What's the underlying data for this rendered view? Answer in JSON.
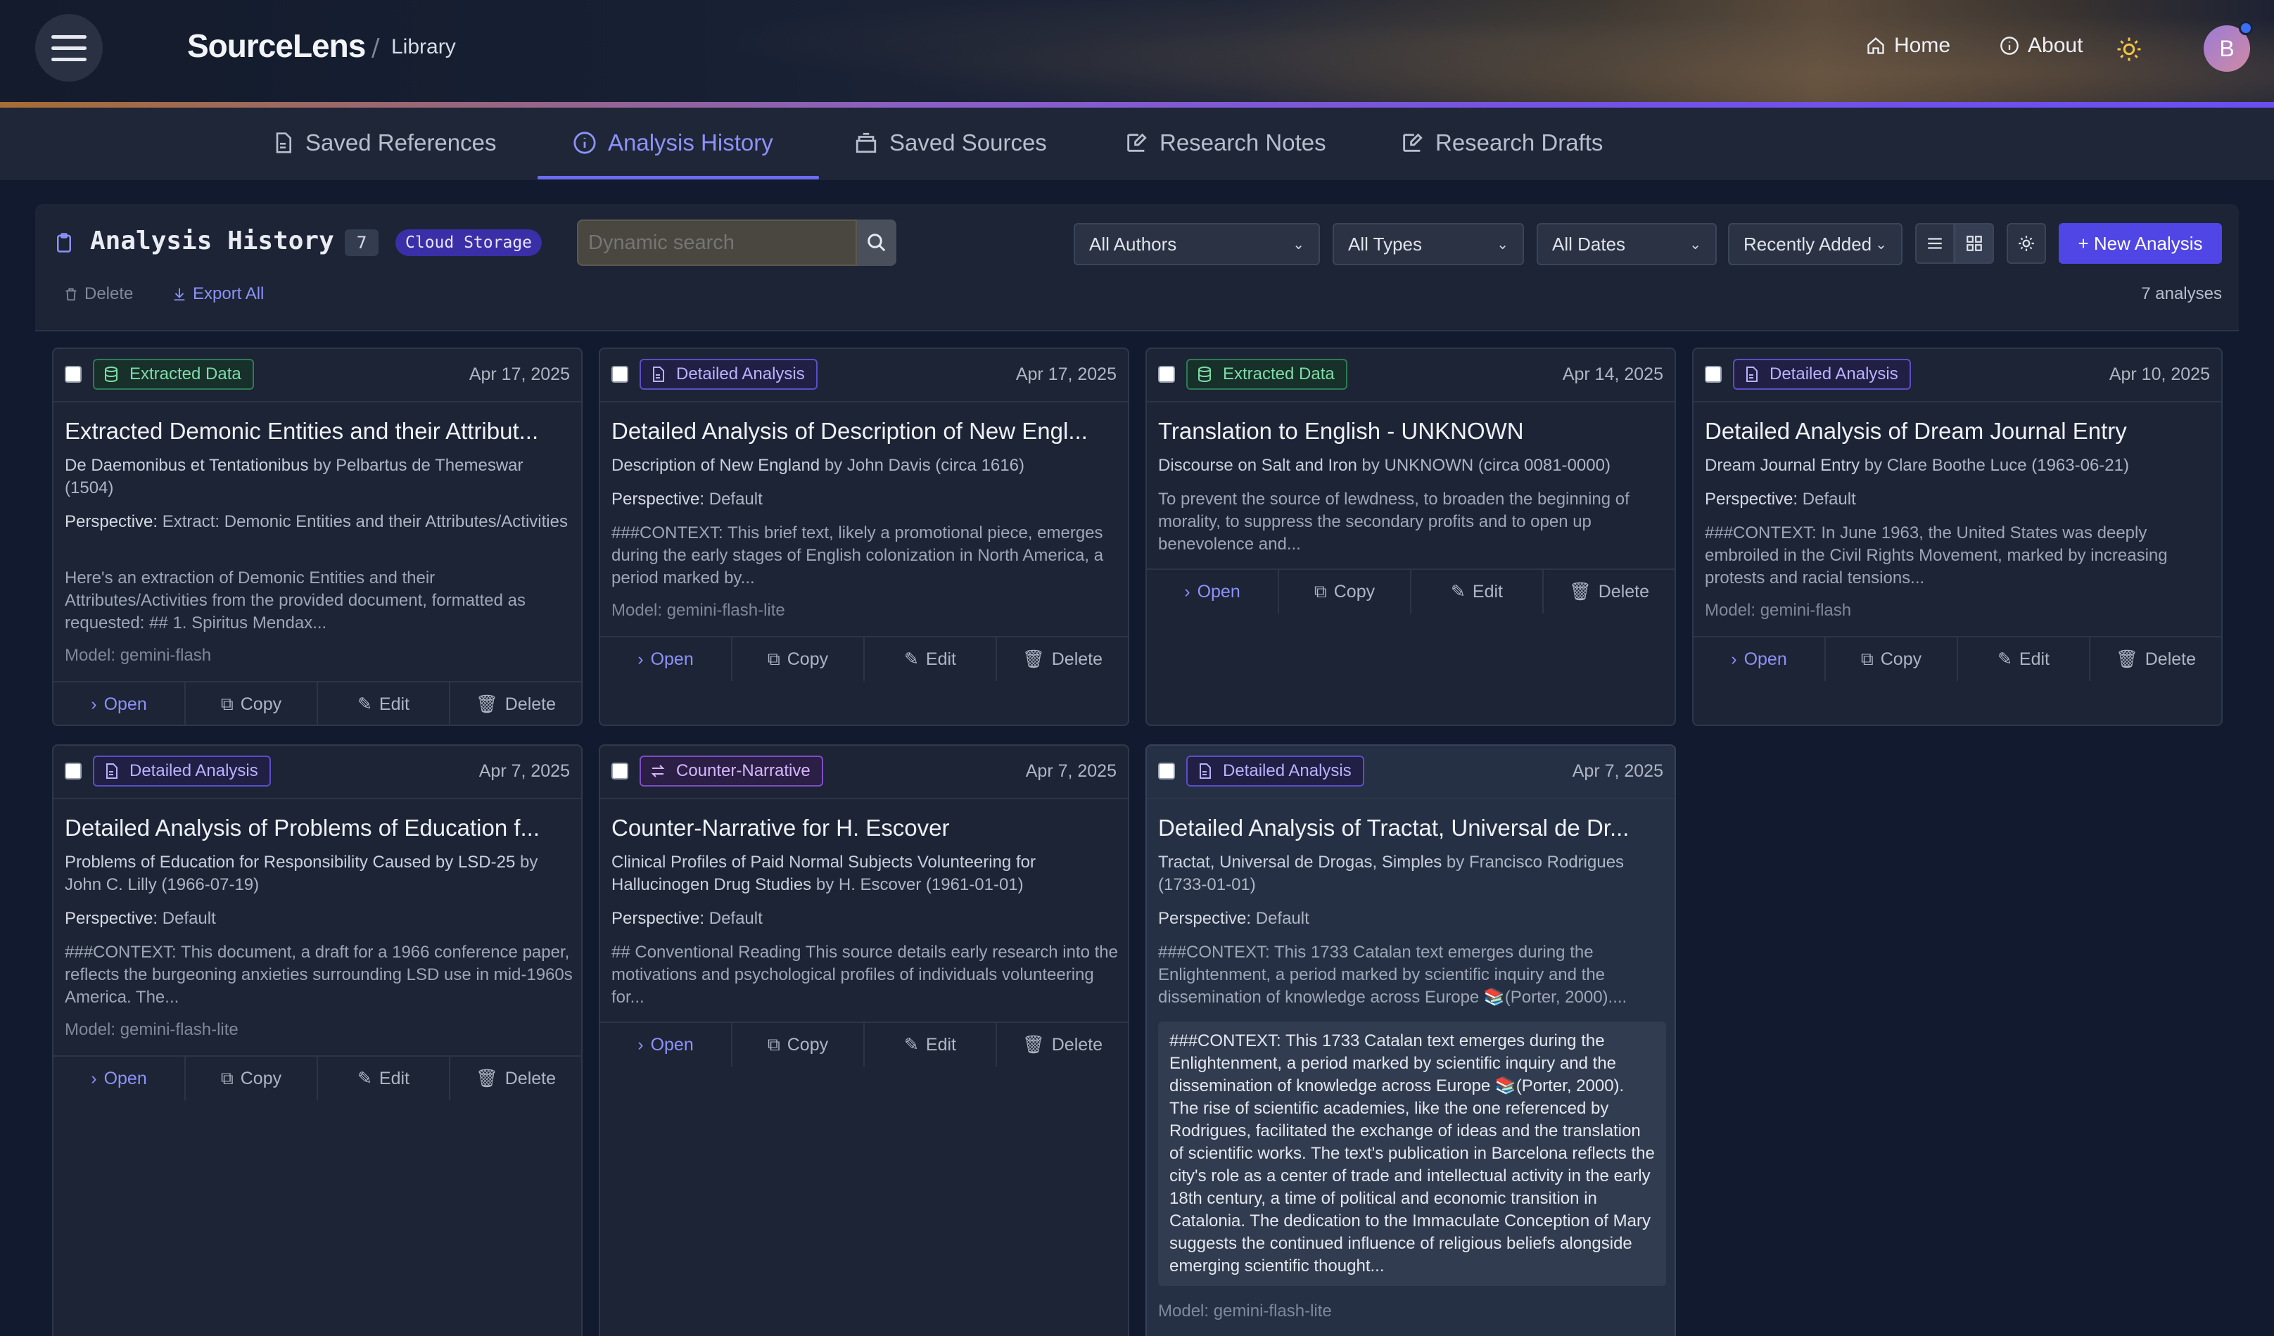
{
  "header": {
    "brand": "SourceLens",
    "separator": "/",
    "section": "Library",
    "nav": {
      "home": "Home",
      "about": "About"
    },
    "avatar_initial": "B"
  },
  "tabs": [
    {
      "label": "Saved References",
      "icon": "document-icon",
      "active": false
    },
    {
      "label": "Analysis History",
      "icon": "info-circle-icon",
      "active": true
    },
    {
      "label": "Saved Sources",
      "icon": "archive-icon",
      "active": false
    },
    {
      "label": "Research Notes",
      "icon": "edit-icon",
      "active": false
    },
    {
      "label": "Research Drafts",
      "icon": "edit-icon",
      "active": false
    }
  ],
  "panel": {
    "title": "Analysis History",
    "count": "7",
    "storage_badge": "Cloud Storage",
    "search_placeholder": "Dynamic search",
    "filters": {
      "authors": "All Authors",
      "types": "All Types",
      "dates": "All Dates",
      "sort": "Recently Added"
    },
    "new_button": "+ New Analysis",
    "delete_label": "Delete",
    "export_label": "Export All",
    "total": "7 analyses"
  },
  "card_actions": {
    "open": "Open",
    "copy": "Copy",
    "edit": "Edit",
    "delete": "Delete"
  },
  "cards": [
    {
      "type": "Extracted Data",
      "date": "Apr 17, 2025",
      "title": "Extracted Demonic Entities and their Attribut...",
      "source_title": "De Daemonibus et Tentationibus",
      "source_by": " by Pelbartus de Themeswar (1504)",
      "perspective_label": "Perspective:",
      "perspective": " Extract: Demonic Entities and their Attributes/Activities",
      "excerpt": "Here's an extraction of Demonic Entities and their Attributes/Activities from the provided document, formatted as requested: ## 1. Spiritus Mendax...",
      "model": "Model: gemini-flash"
    },
    {
      "type": "Detailed Analysis",
      "date": "Apr 17, 2025",
      "title": "Detailed Analysis of Description of New Engl...",
      "source_title": "Description of New England",
      "source_by": " by John Davis (circa 1616)",
      "perspective_label": "Perspective:",
      "perspective": " Default",
      "excerpt": "###CONTEXT: This brief text, likely a promotional piece, emerges during the early stages of English colonization in North America, a period marked by...",
      "model": "Model: gemini-flash-lite"
    },
    {
      "type": "Extracted Data",
      "date": "Apr 14, 2025",
      "title": "Translation to English - UNKNOWN",
      "source_title": "Discourse on Salt and Iron",
      "source_by": " by UNKNOWN (circa 0081-0000)",
      "excerpt": "To prevent the source of lewdness, to broaden the beginning of morality, to suppress the secondary profits and to open up benevolence and..."
    },
    {
      "type": "Detailed Analysis",
      "date": "Apr 10, 2025",
      "title": "Detailed Analysis of Dream Journal Entry",
      "source_title": "Dream Journal Entry",
      "source_by": " by Clare Boothe Luce (1963-06-21)",
      "perspective_label": "Perspective:",
      "perspective": " Default",
      "excerpt": "###CONTEXT: In June 1963, the United States was deeply embroiled in the Civil Rights Movement, marked by increasing protests and racial tensions...",
      "model": "Model: gemini-flash"
    },
    {
      "type": "Detailed Analysis",
      "date": "Apr 7, 2025",
      "title": "Detailed Analysis of Problems of Education f...",
      "source_title": "Problems of Education for Responsibility Caused by LSD-25",
      "source_by": " by John C. Lilly (1966-07-19)",
      "perspective_label": "Perspective:",
      "perspective": " Default",
      "excerpt": "###CONTEXT: This document, a draft for a 1966 conference paper, reflects the burgeoning anxieties surrounding LSD use in mid-1960s America. The...",
      "model": "Model: gemini-flash-lite"
    },
    {
      "type": "Counter-Narrative",
      "date": "Apr 7, 2025",
      "title": "Counter-Narrative for H. Escover",
      "source_title": "Clinical Profiles of Paid Normal Subjects Volunteering for Hallucinogen Drug Studies",
      "source_by": " by H. Escover (1961-01-01)",
      "perspective_label": "Perspective:",
      "perspective": " Default",
      "excerpt": "## Conventional Reading This source details early research into the motivations and psychological profiles of individuals volunteering for..."
    },
    {
      "type": "Detailed Analysis",
      "date": "Apr 7, 2025",
      "title": "Detailed Analysis of Tractat, Universal de Dr...",
      "source_title": "Tractat, Universal de Drogas, Simples",
      "source_by": " by Francisco Rodrigues (1733-01-01)",
      "perspective_label": "Perspective:",
      "perspective": " Default",
      "excerpt": "###CONTEXT: This 1733 Catalan text emerges during the Enlightenment, a period marked by scientific inquiry and the dissemination of knowledge across Europe 📚(Porter, 2000)....",
      "expanded": "###CONTEXT: This 1733 Catalan text emerges during the Enlightenment, a period marked by scientific inquiry and the dissemination of knowledge across Europe 📚(Porter, 2000). The rise of scientific academies, like the one referenced by Rodrigues, facilitated the exchange of ideas and the translation of scientific works. The text's publication in Barcelona reflects the city's role as a center of trade and intellectual activity in the early 18th century, a time of political and economic transition in Catalonia. The dedication to the Immaculate Conception of Mary suggests the continued influence of religious beliefs alongside emerging scientific thought...",
      "model": "Model: gemini-flash-lite"
    }
  ],
  "colors": {
    "accent": "#4f46e5",
    "active_tab": "#8d92f7",
    "extract_badge": "#7ddca7",
    "detail_badge": "#b9b2ff",
    "counter_badge": "#d6b6ff"
  }
}
